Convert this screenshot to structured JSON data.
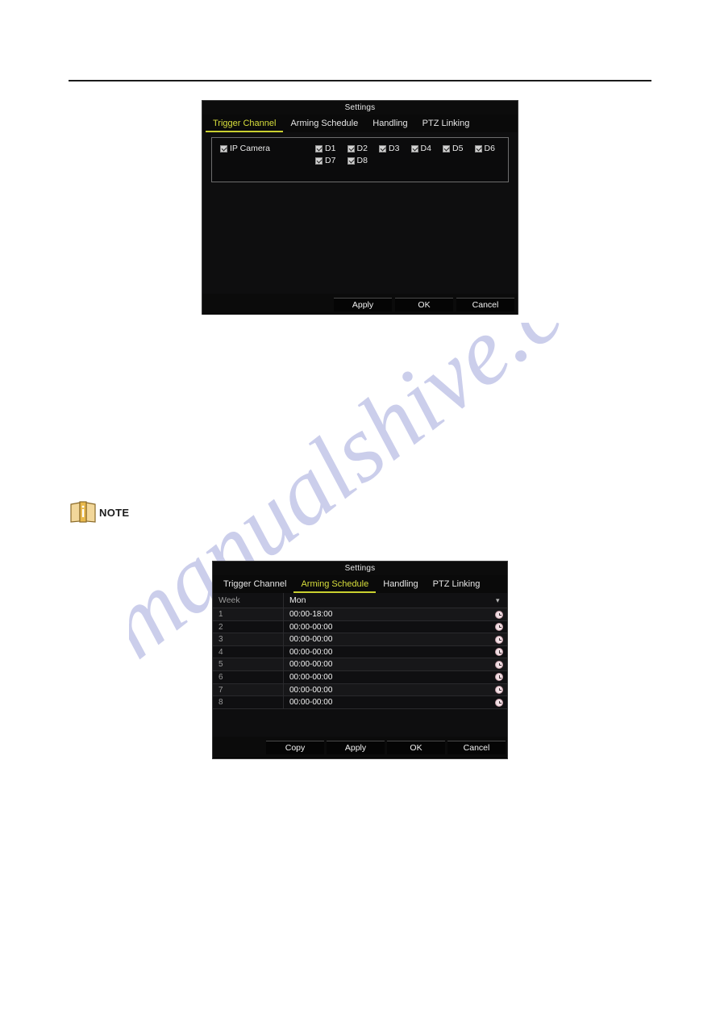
{
  "page": {
    "note_label": "NOTE",
    "watermark_text": "manualshive.com"
  },
  "trigger_dialog": {
    "title": "Settings",
    "tabs": [
      {
        "label": "Trigger Channel",
        "active": true
      },
      {
        "label": "Arming Schedule",
        "active": false
      },
      {
        "label": "Handling",
        "active": false
      },
      {
        "label": "PTZ Linking",
        "active": false
      }
    ],
    "ip_camera_label": "IP Camera",
    "ip_camera_checked": true,
    "channels": [
      {
        "label": "D1",
        "checked": true
      },
      {
        "label": "D2",
        "checked": true
      },
      {
        "label": "D3",
        "checked": true
      },
      {
        "label": "D4",
        "checked": true
      },
      {
        "label": "D5",
        "checked": true
      },
      {
        "label": "D6",
        "checked": true
      },
      {
        "label": "D7",
        "checked": true
      },
      {
        "label": "D8",
        "checked": true
      }
    ],
    "buttons": [
      {
        "label": "Apply"
      },
      {
        "label": "OK"
      },
      {
        "label": "Cancel"
      }
    ]
  },
  "schedule_dialog": {
    "title": "Settings",
    "tabs": [
      {
        "label": "Trigger Channel",
        "active": false
      },
      {
        "label": "Arming Schedule",
        "active": true
      },
      {
        "label": "Handling",
        "active": false
      },
      {
        "label": "PTZ Linking",
        "active": false
      }
    ],
    "week": {
      "label": "Week",
      "value": "Mon",
      "chevron": "chevron-down-icon"
    },
    "rows": [
      {
        "index": "1",
        "time": "00:00-18:00"
      },
      {
        "index": "2",
        "time": "00:00-00:00"
      },
      {
        "index": "3",
        "time": "00:00-00:00"
      },
      {
        "index": "4",
        "time": "00:00-00:00"
      },
      {
        "index": "5",
        "time": "00:00-00:00"
      },
      {
        "index": "6",
        "time": "00:00-00:00"
      },
      {
        "index": "7",
        "time": "00:00-00:00"
      },
      {
        "index": "8",
        "time": "00:00-00:00"
      }
    ],
    "buttons": [
      {
        "label": "Copy"
      },
      {
        "label": "Apply"
      },
      {
        "label": "OK"
      },
      {
        "label": "Cancel"
      }
    ]
  },
  "colors": {
    "accent_tab": "#d8df3c",
    "dialog_bg": "#000000",
    "note_icon": "#e8c98a",
    "watermark": "#b9bce0"
  }
}
